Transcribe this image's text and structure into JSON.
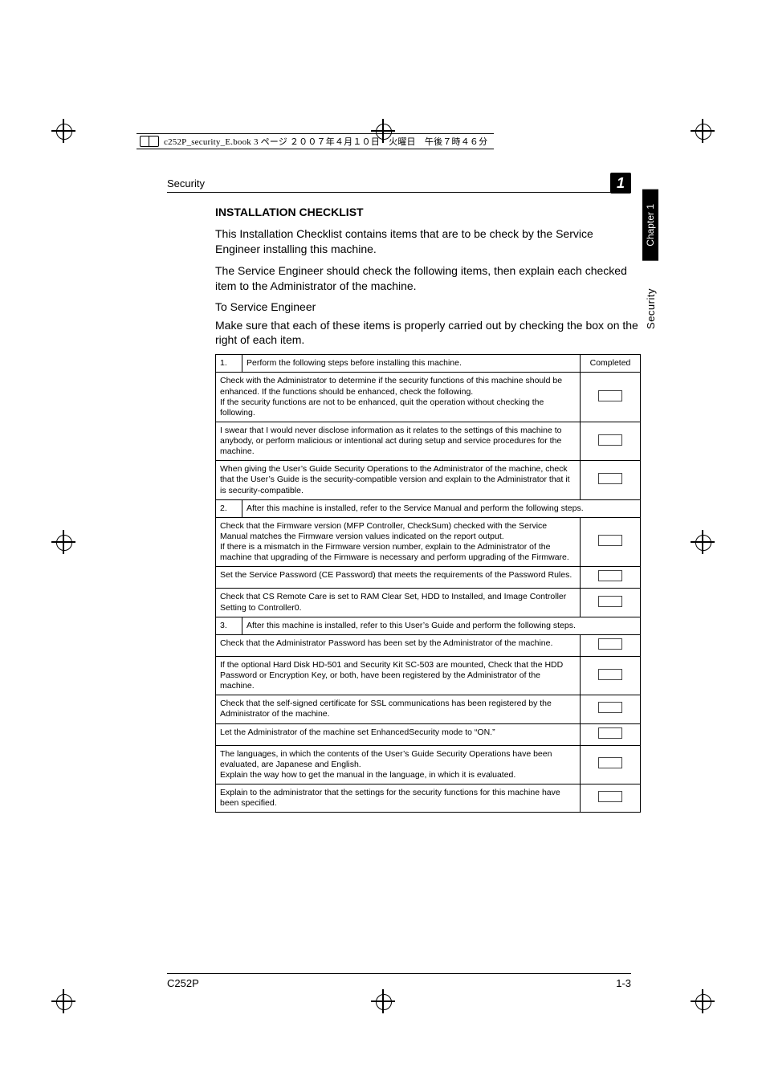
{
  "file_trace": "c252P_security_E.book  3 ページ  ２００７年４月１０日　火曜日　午後７時４６分",
  "running_section": "Security",
  "chapter_number": "1",
  "side_tab_chapter": "Chapter 1",
  "side_tab_section": "Security",
  "heading": "INSTALLATION CHECKLIST",
  "intro_paragraphs": [
    "This Installation Checklist contains items that are to be check by the Service Engineer installing this machine.",
    "The Service Engineer should check the following items, then explain each checked item to the Administrator of the machine."
  ],
  "to_line": "To Service Engineer",
  "instruction": "Make sure that each of these items is properly carried out by checking the box on the right of each item.",
  "completed_header": "Completed",
  "checklist": [
    {
      "num": "1.",
      "text": "Perform the following steps before installing this machine.",
      "has_check": false
    },
    {
      "num": "",
      "text": "Check with the Administrator to determine if the security functions of this machine should be enhanced. If the functions should be enhanced, check the following.\nIf the security functions are not to be enhanced, quit the operation without checking the following.",
      "has_check": true
    },
    {
      "num": "",
      "text": "I swear that I would never disclose information as it relates to the settings of this machine to anybody, or perform malicious or intentional act during setup and service procedures for the machine.",
      "has_check": true
    },
    {
      "num": "",
      "text": "When giving the User’s Guide Security Operations to the Administrator of the machine, check that the User’s Guide is the security-compatible version and explain to the Administrator that it is security-compatible.",
      "has_check": true
    },
    {
      "num": "2.",
      "text": "After this machine is installed, refer to the Service Manual and perform the following steps.",
      "has_check": false
    },
    {
      "num": "",
      "text": "Check that the Firmware version (MFP Controller, CheckSum) checked with the Service Manual matches the Firmware version values indicated on the report output.\nIf there is a mismatch in the Firmware version number, explain to the Administrator of the machine that upgrading of the Firmware is necessary and perform upgrading of the Firmware.",
      "has_check": true
    },
    {
      "num": "",
      "text": "Set the Service Password (CE Password) that meets the requirements of the Password Rules.",
      "has_check": true
    },
    {
      "num": "",
      "text": "Check that CS Remote Care is set to RAM Clear Set, HDD to Installed, and Image Controller Setting to Controller0.",
      "has_check": true
    },
    {
      "num": "3.",
      "text": "After this machine is installed, refer to this User’s Guide and perform the following steps.",
      "has_check": false
    },
    {
      "num": "",
      "text": "Check that the Administrator Password has been set by the Administrator of the machine.",
      "has_check": true
    },
    {
      "num": "",
      "text": "If the optional Hard Disk HD-501 and Security Kit SC-503 are mounted, Check that the HDD Password or Encryption Key, or both, have been registered by the Administrator of the machine.",
      "has_check": true
    },
    {
      "num": "",
      "text": "Check that the self-signed certificate for SSL communications has been registered by the Administrator of the machine.",
      "has_check": true
    },
    {
      "num": "",
      "text": "Let the Administrator of the machine set EnhancedSecurity mode to “ON.”",
      "has_check": true
    },
    {
      "num": "",
      "text": "The languages, in which the contents of the User’s Guide Security Operations have been evaluated, are Japanese and English.\nExplain the way how to get the manual in the language, in which it is evaluated.",
      "has_check": true
    },
    {
      "num": "",
      "text": "Explain to the administrator that the settings for the security functions for this machine have been specified.",
      "has_check": true
    }
  ],
  "footer_left": "C252P",
  "footer_right": "1-3"
}
